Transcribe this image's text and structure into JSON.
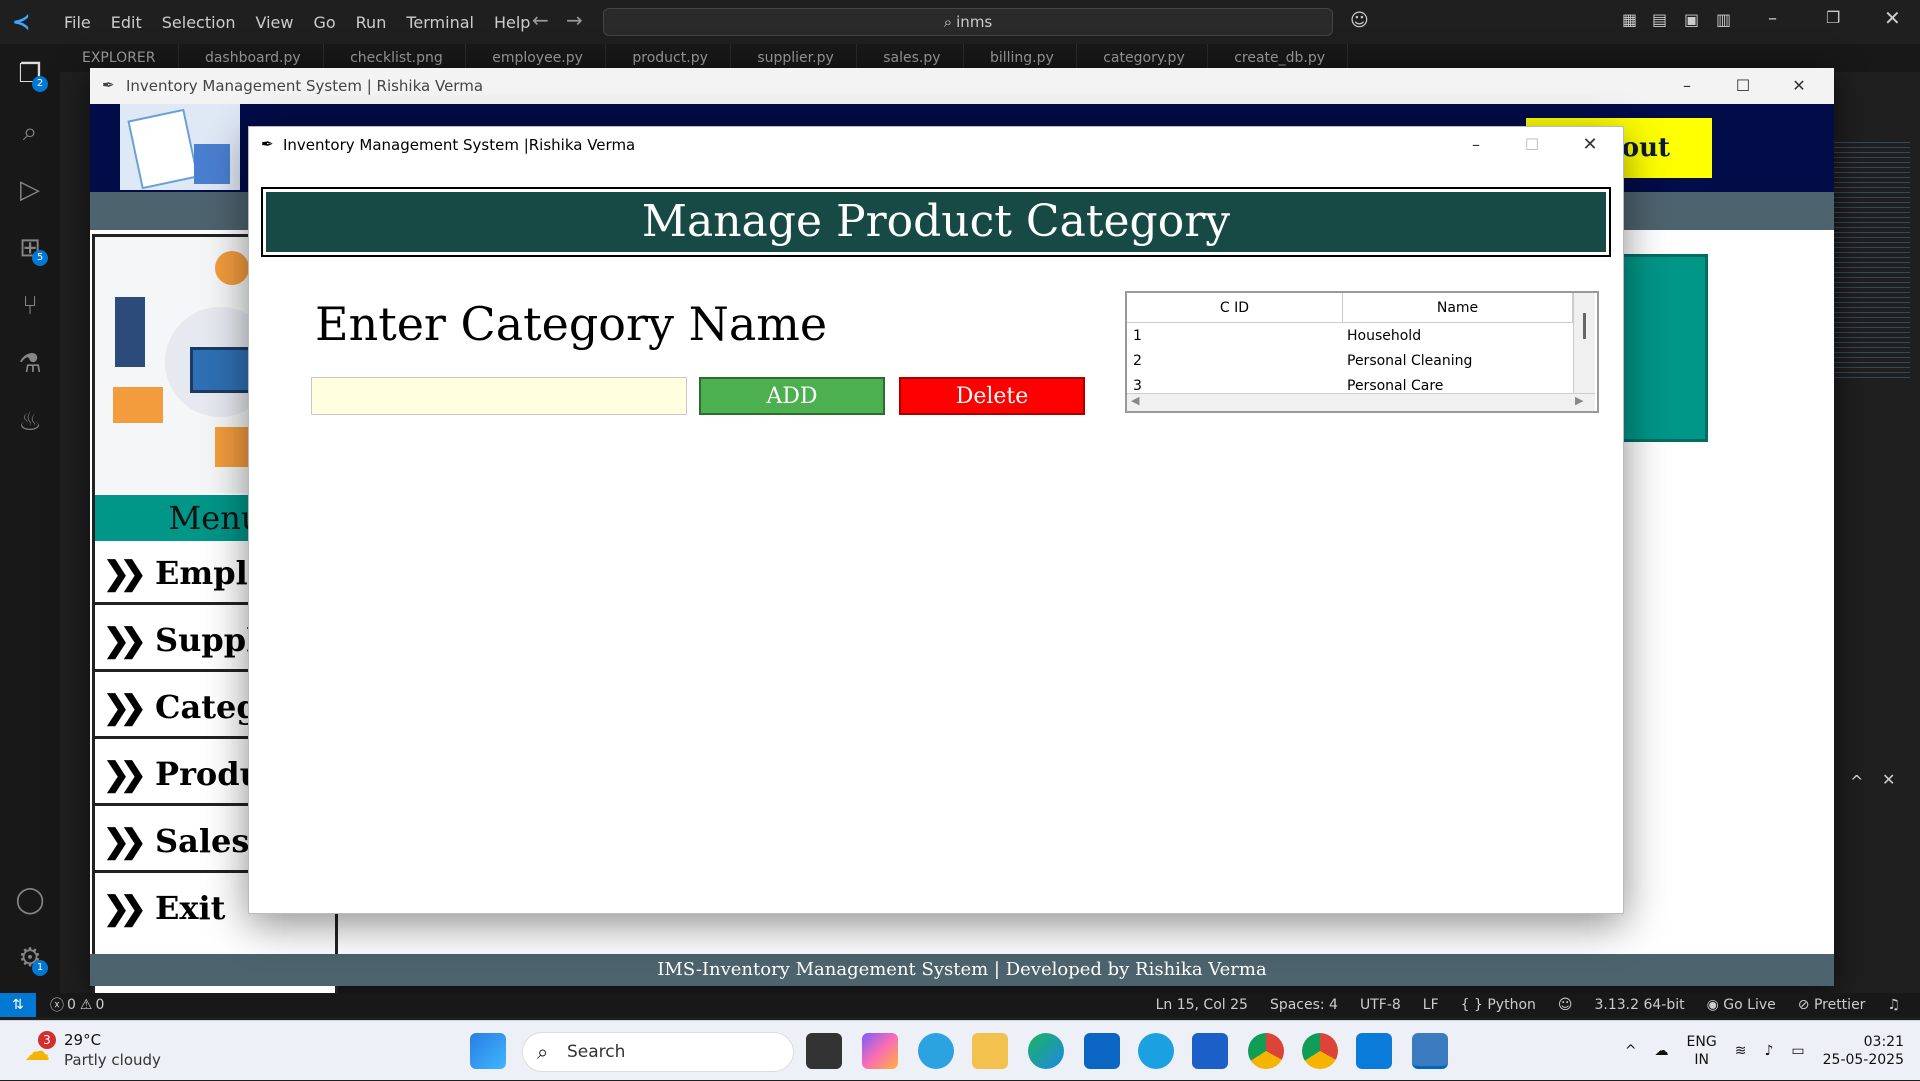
{
  "vscode": {
    "menu": [
      "File",
      "Edit",
      "Selection",
      "View",
      "Go",
      "Run",
      "Terminal",
      "Help"
    ],
    "search_text": "inms",
    "tabs": [
      "EXPLORER",
      "dashboard.py",
      "checklist.png",
      "employee.py",
      "product.py",
      "supplier.py",
      "sales.py",
      "billing.py",
      "category.py",
      "create_db.py"
    ],
    "activity_badges": {
      "explorer": "2",
      "extensions": "5",
      "accounts": "1"
    },
    "status": {
      "errors": "0",
      "warnings": "0",
      "position": "Ln 15, Col 25",
      "spaces": "Spaces: 4",
      "encoding": "UTF-8",
      "eol": "LF",
      "language": "{ } Python",
      "interpreter": "3.13.2 64-bit",
      "golive": "Go Live",
      "prettier": "Prettier"
    }
  },
  "dashboard": {
    "title": "Inventory Management System | Rishika Verma",
    "logout_label": "Logout",
    "menu_title": "Menu",
    "menu_items": [
      "Employee",
      "Supplier",
      "Category",
      "Products",
      "Sales",
      "Exit"
    ],
    "footer": "IMS-Inventory Management System | Developed by Rishika Verma"
  },
  "category_window": {
    "title": "Inventory Management System |Rishika Verma",
    "header": "Manage Product Category",
    "label": "Enter Category Name",
    "input_value": "",
    "add_label": "ADD",
    "delete_label": "Delete",
    "table": {
      "columns": [
        "C ID",
        "Name"
      ],
      "rows": [
        {
          "id": "1",
          "name": "Household"
        },
        {
          "id": "2",
          "name": "Personal Cleaning"
        },
        {
          "id": "3",
          "name": "Personal Care"
        }
      ]
    }
  },
  "taskbar": {
    "weather_temp": "29°C",
    "weather_desc": "Partly cloudy",
    "weather_badge": "3",
    "search_placeholder": "Search",
    "lang_1": "ENG",
    "lang_2": "IN",
    "time": "03:21",
    "date": "25-05-2025"
  },
  "colors": {
    "header_green": "#184a45",
    "add_green": "#4caf50",
    "delete_red": "#ff0000",
    "input_bg": "#ffffe0",
    "teal": "#009688",
    "navy": "#010c48"
  }
}
